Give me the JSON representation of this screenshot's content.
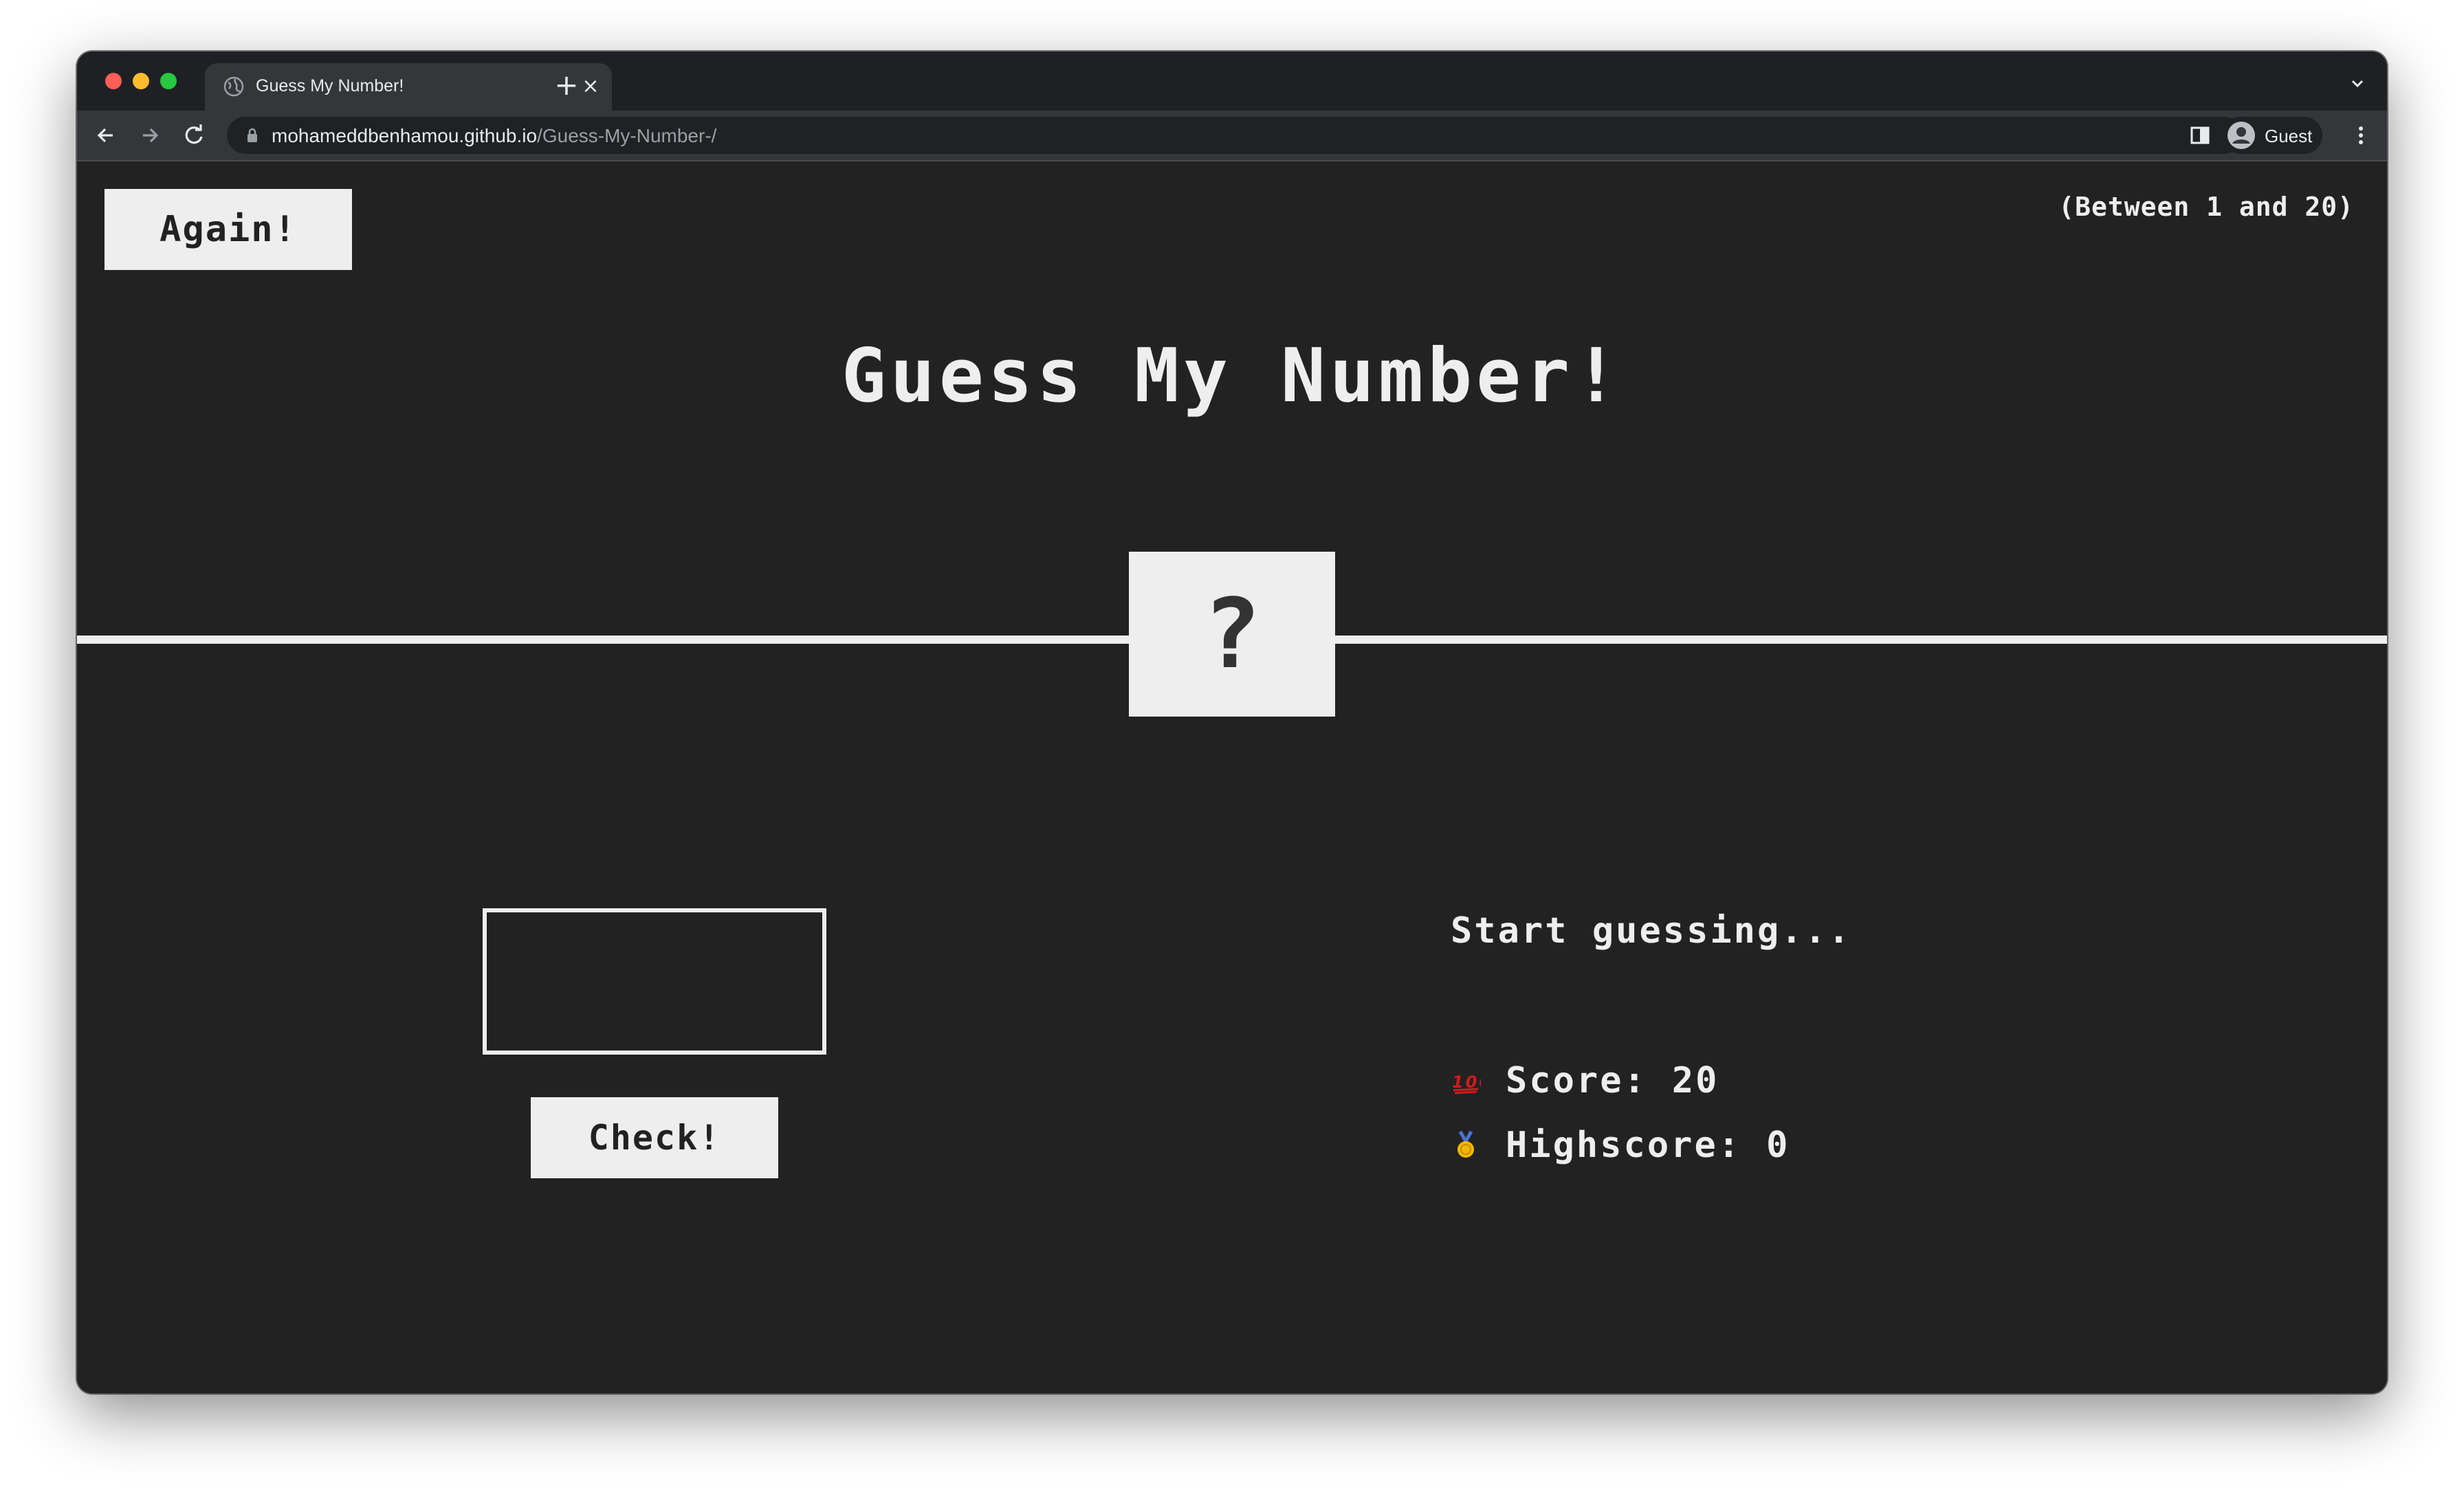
{
  "browser": {
    "tab_title": "Guess My Number!",
    "tab_close_glyph": "×",
    "new_tab_glyph": "+",
    "url_host": "mohameddbenhamou.github.io",
    "url_path": "/Guess-My-Number-/",
    "profile_label": "Guest",
    "icons": [
      "back-icon",
      "forward-icon",
      "reload-icon",
      "lock-icon",
      "side-panel-icon",
      "profile-avatar-icon",
      "more-menu-icon",
      "globe-icon",
      "tab-list-icon"
    ]
  },
  "game": {
    "again_label": "Again!",
    "range_hint": "(Between 1 and 20)",
    "title": "Guess My Number!",
    "secret_number": "?",
    "guess_value": "",
    "check_label": "Check!",
    "message": "Start guessing...",
    "score_label": "Score:",
    "score_value": "20",
    "score_icon": "hundred-points-icon",
    "highscore_label": "Highscore:",
    "highscore_value": "0",
    "highscore_icon": "medal-icon"
  },
  "colors": {
    "page_background": "#222222",
    "foreground": "#eeeeee",
    "browser_frame": "#202124",
    "browser_toolbar": "#35363a"
  }
}
